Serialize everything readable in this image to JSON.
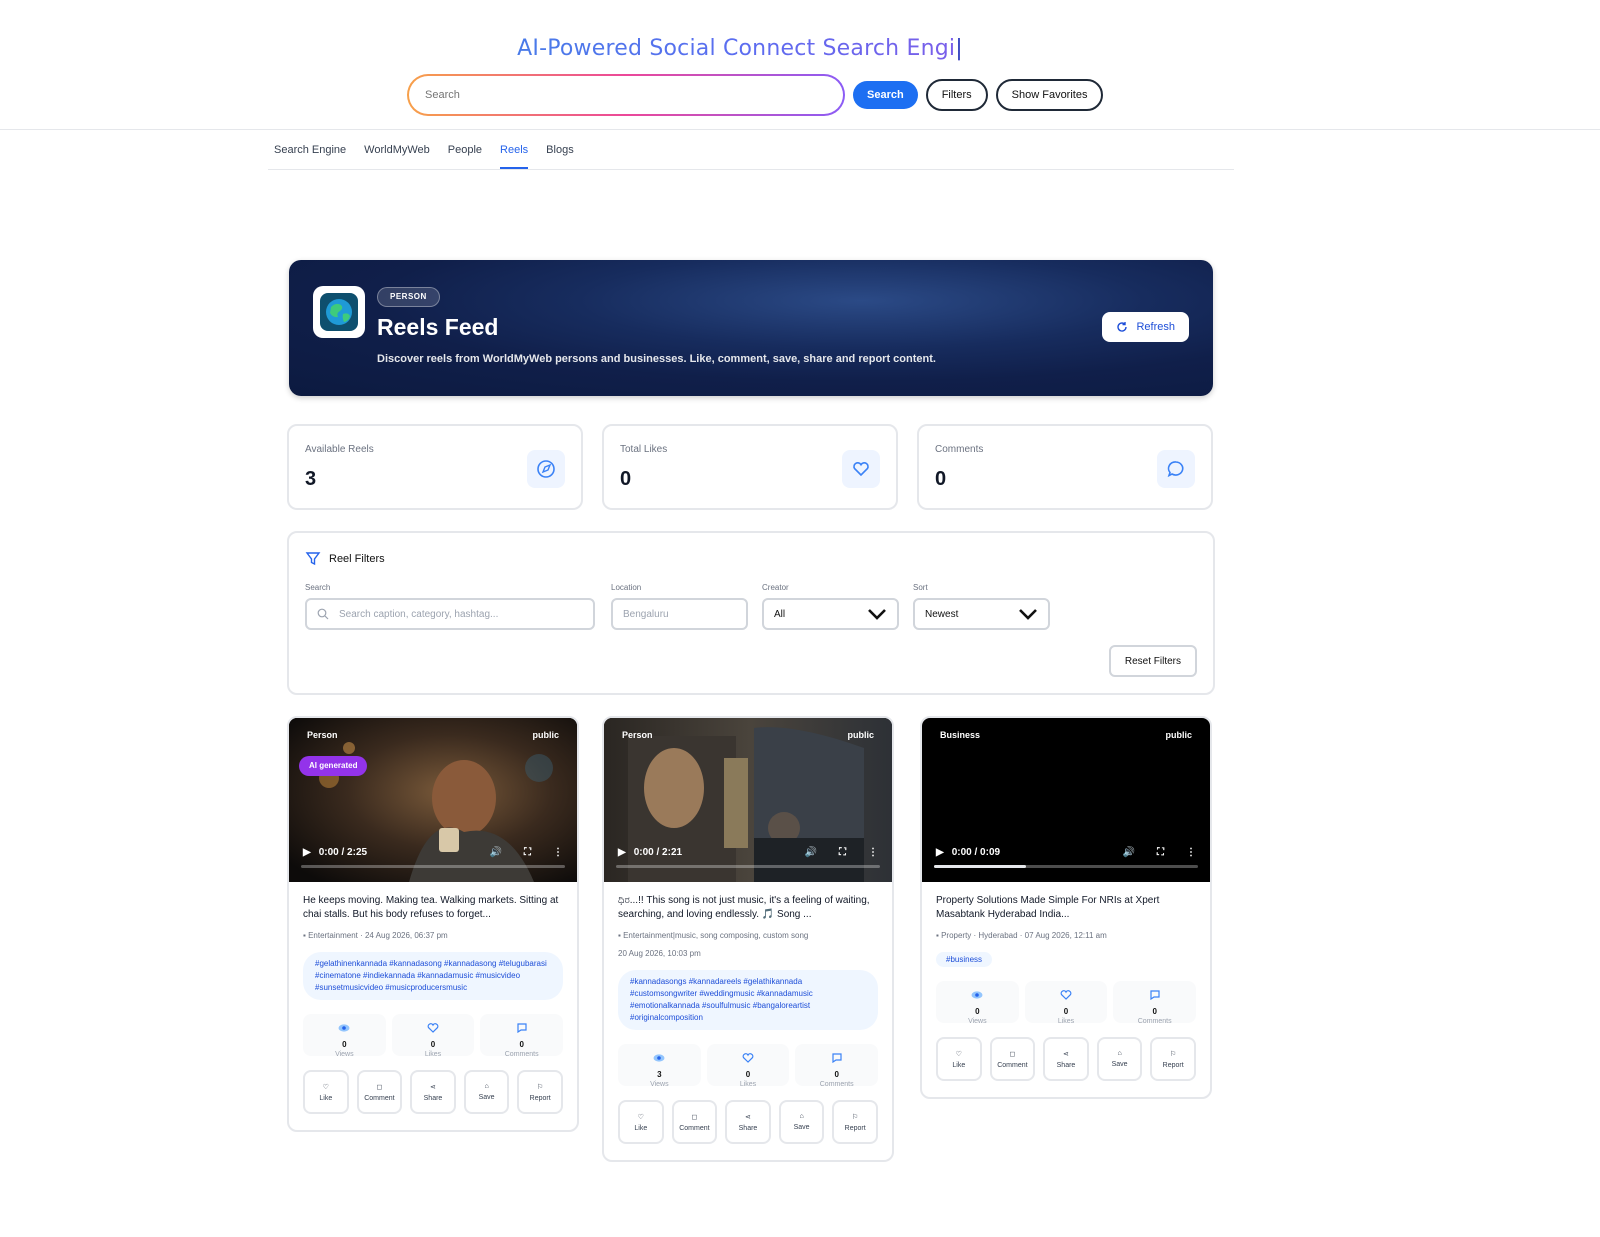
{
  "header": {
    "title": "AI-Powered Social Connect Search Engi",
    "caret": "|",
    "search_placeholder": "Search",
    "search_button": "Search",
    "filters_button": "Filters",
    "favorites_button": "Show Favorites"
  },
  "tabs": [
    {
      "label": "Search Engine",
      "active": false
    },
    {
      "label": "WorldMyWeb",
      "active": false
    },
    {
      "label": "People",
      "active": false
    },
    {
      "label": "Reels",
      "active": true
    },
    {
      "label": "Blogs",
      "active": false
    }
  ],
  "hero": {
    "badge": "PERSON",
    "title": "Reels Feed",
    "description": "Discover reels from WorldMyWeb persons and businesses. Like, comment, save, share and report content.",
    "refresh_label": "Refresh",
    "logo_icon": "globe-icon"
  },
  "stats": [
    {
      "label": "Available Reels",
      "value": "3",
      "icon": "compass-icon"
    },
    {
      "label": "Total Likes",
      "value": "0",
      "icon": "heart-icon"
    },
    {
      "label": "Comments",
      "value": "0",
      "icon": "comment-icon"
    }
  ],
  "filters": {
    "title": "Reel Filters",
    "search_label": "Search",
    "search_placeholder": "Search caption, category, hashtag...",
    "location_label": "Location",
    "location_placeholder": "Bengaluru",
    "creator_label": "Creator",
    "creator_value": "All",
    "sort_label": "Sort",
    "sort_value": "Newest",
    "reset_label": "Reset Filters"
  },
  "reels": [
    {
      "type": "Person",
      "visibility": "public",
      "ai_badge": "AI generated",
      "time": "0:00 / 2:25",
      "progress": 0,
      "caption": "He keeps moving. Making tea. Walking markets. Sitting at chai stalls. But his body refuses to forget...",
      "meta": "Entertainment · 24 Aug 2026, 06:37 pm",
      "hashtags": "#gelathinenkannada #kannadasong #kannadasong #telugubarasi #cinematone #indiekannada #kannadamusic #musicvideo #sunsetmusicvideo #musicproducersmusic",
      "views": "0",
      "likes": "0",
      "comments": "0"
    },
    {
      "type": "Person",
      "visibility": "public",
      "ai_badge": "",
      "time": "0:00 / 2:21",
      "progress": 0,
      "caption": "ಧಿರ...!! This song is not just music, it's a feeling of waiting, searching, and loving endlessly. 🎵 Song ...",
      "meta": "Entertainment|music, song composing, custom song",
      "meta2": "20 Aug 2026, 10:03 pm",
      "hashtags": "#kannadasongs #kannadareels #gelathikannada #customsongwriter #weddingmusic #kannadamusic #emotionalkannada #soulfulmusic #bangaloreartist #originalcomposition",
      "views": "3",
      "likes": "0",
      "comments": "0"
    },
    {
      "type": "Business",
      "visibility": "public",
      "ai_badge": "",
      "time": "0:00 / 0:09",
      "progress": 0.35,
      "caption": "Property Solutions Made Simple For NRIs at Xpert Masabtank Hyderabad India...",
      "meta": "Property · Hyderabad · 07 Aug 2026, 12:11 am",
      "hashtag_pill": "#business",
      "views": "0",
      "likes": "0",
      "comments": "0"
    }
  ],
  "metric_labels": {
    "views": "Views",
    "likes": "Likes",
    "comments": "Comments"
  },
  "actions": {
    "like": "Like",
    "comment": "Comment",
    "share": "Share",
    "save": "Save",
    "report": "Report"
  }
}
